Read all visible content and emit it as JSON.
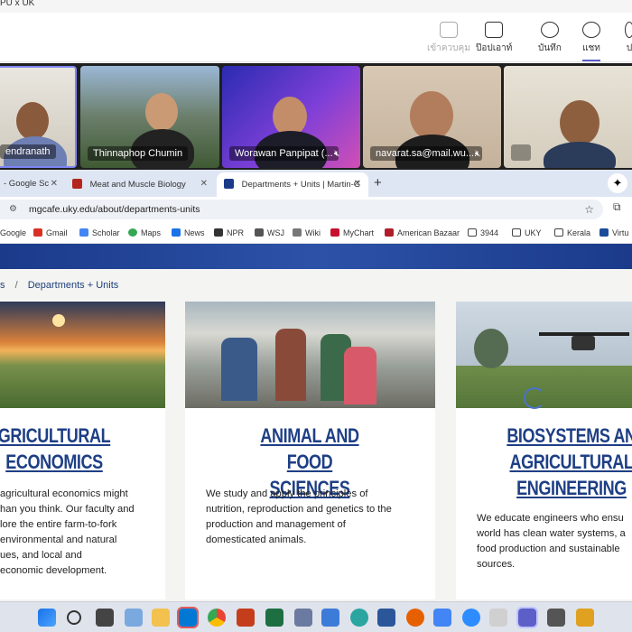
{
  "window_title": "PU x UK",
  "teams_toolbar": {
    "buttons": [
      {
        "label": "เข้าควบคุม"
      },
      {
        "label": "ป๊อปเอาท์"
      },
      {
        "label": "บันทึก"
      },
      {
        "label": "แชท"
      },
      {
        "label": "ป"
      }
    ]
  },
  "participants": [
    {
      "name": "endranath"
    },
    {
      "name": "Thinnaphop Chumin"
    },
    {
      "name": "Worawan Panpipat (..."
    },
    {
      "name": "navarat.sa@mail.wu...."
    },
    {
      "name": ""
    }
  ],
  "browser": {
    "tabs": [
      {
        "label": "- Google Sc"
      },
      {
        "label": "Meat and Muscle Biology"
      },
      {
        "label": "Departments + Units | Martin-G"
      }
    ],
    "new_tab": "+",
    "url": "mgcafe.uky.edu/about/departments-units",
    "bookmarks": [
      "Google",
      "Gmail",
      "Scholar",
      "Maps",
      "News",
      "NPR",
      "WSJ",
      "Wiki",
      "MyChart",
      "American Bazaar",
      "3944",
      "UKY",
      "Kerala",
      "Virtu"
    ]
  },
  "page": {
    "breadcrumb": {
      "separator": "/",
      "current": "Departments + Units",
      "prev": "s"
    },
    "cards": [
      {
        "title_lines": [
          "GRICULTURAL",
          "ECONOMICS"
        ],
        "body_lines": [
          "agricultural economics might",
          "han you think. Our faculty and",
          "lore the entire farm-to-fork",
          "environmental and natural",
          "ues, and local and",
          "economic development."
        ]
      },
      {
        "title_lines": [
          "ANIMAL AND FOOD",
          "SCIENCES"
        ],
        "body_lines": [
          "We study and apply the principles of",
          "nutrition, reproduction and genetics to the",
          "production and management of",
          "domesticated animals."
        ]
      },
      {
        "title_lines": [
          "BIOSYSTEMS AN",
          "AGRICULTURAL",
          "ENGINEERING"
        ],
        "body_lines": [
          "We educate engineers who ensu",
          "world has clean water systems, a",
          "food production and sustainable",
          "sources."
        ]
      }
    ]
  }
}
